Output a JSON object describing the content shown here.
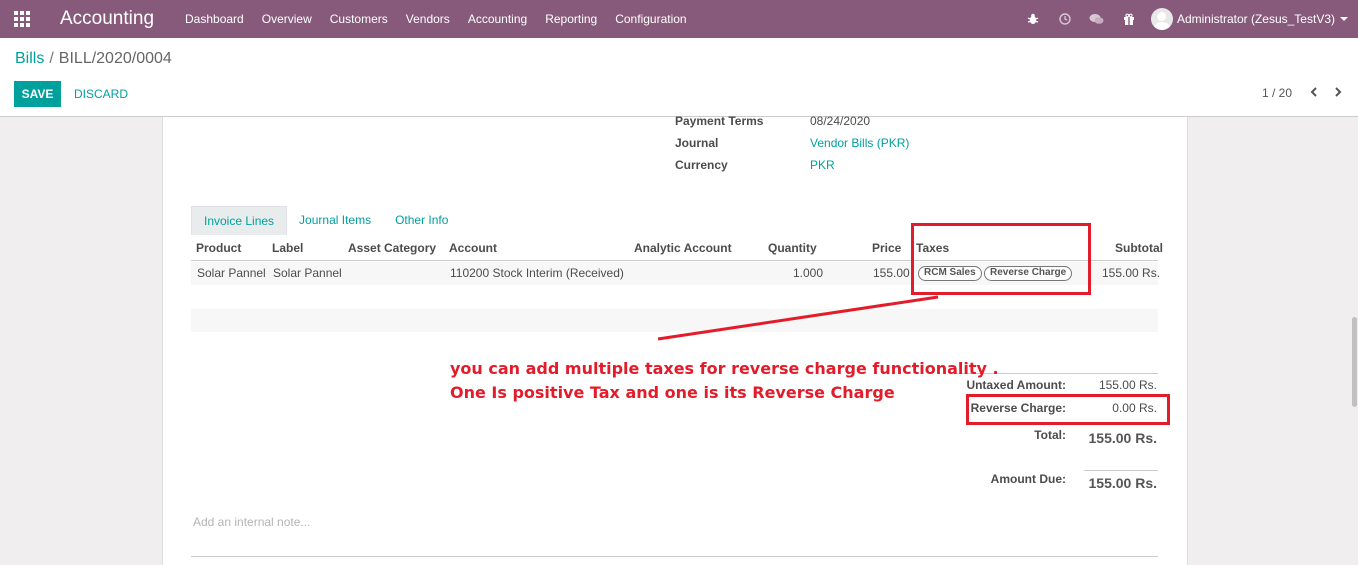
{
  "navbar": {
    "app_title": "Accounting",
    "menu": [
      "Dashboard",
      "Overview",
      "Customers",
      "Vendors",
      "Accounting",
      "Reporting",
      "Configuration"
    ],
    "user": "Administrator (Zesus_TestV3)",
    "background_color": "#875a7b",
    "icons": [
      "apps-grid-icon",
      "bug-icon",
      "clock-icon",
      "chat-icon",
      "gift-icon",
      "avatar-icon"
    ]
  },
  "control_panel": {
    "breadcrumb_root": "Bills",
    "breadcrumb_sep": "/",
    "breadcrumb_current": "BILL/2020/0004",
    "save_label": "SAVE",
    "discard_label": "DISCARD",
    "pager": "1 / 20",
    "accent_color": "#00a09d"
  },
  "header_fields": {
    "payment_terms_label": "Payment Terms",
    "payment_terms_value": "08/24/2020",
    "journal_label": "Journal",
    "journal_value": "Vendor Bills (PKR)",
    "currency_label": "Currency",
    "currency_value": "PKR"
  },
  "tabs": {
    "invoice_lines": "Invoice Lines",
    "journal_items": "Journal Items",
    "other_info": "Other Info"
  },
  "table": {
    "columns": {
      "product": "Product",
      "label": "Label",
      "asset_category": "Asset Category",
      "account": "Account",
      "analytic_account": "Analytic Account",
      "quantity": "Quantity",
      "price": "Price",
      "taxes": "Taxes",
      "subtotal": "Subtotal"
    },
    "rows": [
      {
        "product": "Solar Pannel",
        "label": "Solar Pannel",
        "asset_category": "",
        "account": "110200 Stock Interim (Received)",
        "analytic_account": "",
        "quantity": "1.000",
        "price": "155.00",
        "taxes": [
          "RCM Sales",
          "Reverse Charge"
        ],
        "subtotal": "155.00 Rs."
      }
    ]
  },
  "totals": {
    "untaxed_label": "Untaxed Amount:",
    "untaxed_value": "155.00 Rs.",
    "reverse_label": "Reverse Charge:",
    "reverse_value": "0.00 Rs.",
    "total_label": "Total:",
    "total_value": "155.00 Rs.",
    "amount_due_label": "Amount Due:",
    "amount_due_value": "155.00 Rs."
  },
  "note_placeholder": "Add an internal note...",
  "annotation": {
    "line1": "you can add multiple taxes for reverse charge functionality .",
    "line2": "One Is positive Tax and one is its Reverse Charge",
    "color": "#e21c2a"
  }
}
